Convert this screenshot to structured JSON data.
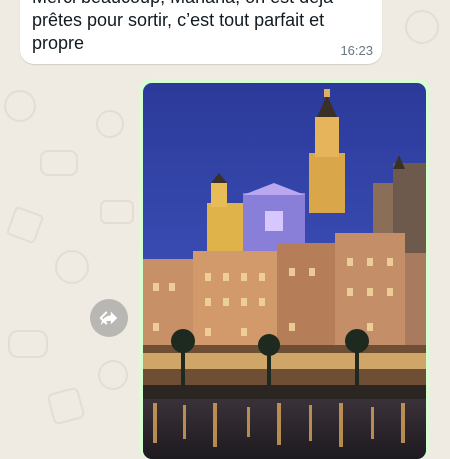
{
  "incoming_message": {
    "text": "Merci beaucoup, Mariana, on est déjà prêtes pour sortir, c’est tout parfait et propre",
    "time": "16:23"
  },
  "outgoing_message": {
    "type": "image",
    "image_subject": "photo"
  },
  "icons": {
    "forward": "forward-arrow-icon"
  },
  "colors": {
    "chat_background": "#efeae2",
    "incoming_bubble": "#ffffff",
    "outgoing_bubble": "#d9fdd3",
    "timestamp": "#667781",
    "forward_button": "#8c8c8c"
  }
}
